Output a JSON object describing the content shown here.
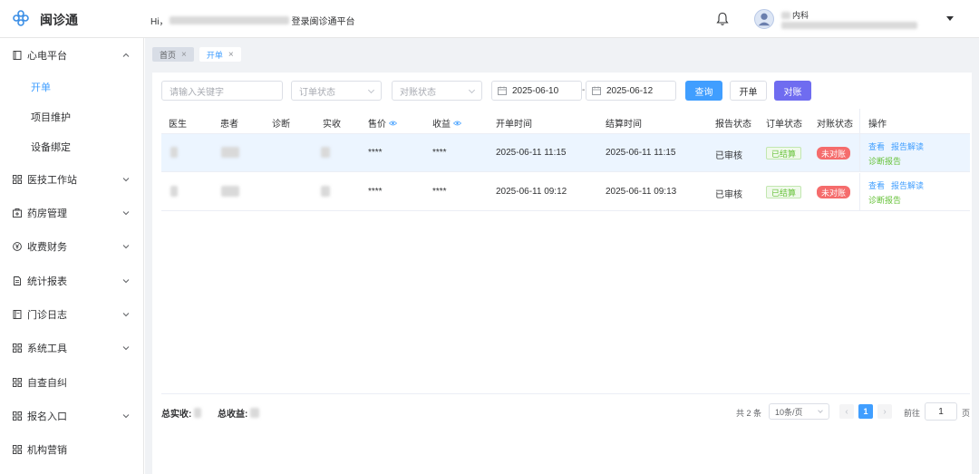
{
  "header": {
    "brand": "闽诊通",
    "greeting_prefix": "Hi，",
    "greeting_suffix": "登录闽诊通平台",
    "user_dept": "内科"
  },
  "sidebar": {
    "groups": [
      {
        "label": "心电平台",
        "icon": "book-icon",
        "expanded": true,
        "children": [
          {
            "label": "开单",
            "active": true
          },
          {
            "label": "项目维护"
          },
          {
            "label": "设备绑定"
          }
        ]
      },
      {
        "label": "医技工作站",
        "icon": "grid-icon"
      },
      {
        "label": "药房管理",
        "icon": "pharmacy-icon"
      },
      {
        "label": "收费财务",
        "icon": "yen-icon"
      },
      {
        "label": "统计报表",
        "icon": "document-icon"
      },
      {
        "label": "门诊日志",
        "icon": "notebook-icon"
      },
      {
        "label": "系统工具",
        "icon": "grid-icon"
      },
      {
        "label": "自查自纠",
        "icon": "grid-icon"
      },
      {
        "label": "报名入口",
        "icon": "grid-icon"
      },
      {
        "label": "机构营销",
        "icon": "grid-icon"
      }
    ]
  },
  "tabs": [
    {
      "label": "首页"
    },
    {
      "label": "开单",
      "active": true
    }
  ],
  "filters": {
    "keyword_placeholder": "请输入关键字",
    "order_status_placeholder": "订单状态",
    "recon_status_placeholder": "对账状态",
    "date_start": "2025-06-10",
    "date_end": "2025-06-12",
    "date_separator": "-",
    "query_label": "查询",
    "create_label": "开单",
    "reconcile_label": "对账"
  },
  "table": {
    "columns": [
      "医生",
      "患者",
      "诊断",
      "实收",
      "售价",
      "收益",
      "开单时间",
      "结算时间",
      "报告状态",
      "订单状态",
      "对账状态",
      "操作"
    ],
    "rows": [
      {
        "price": "****",
        "profit": "****",
        "open_time": "2025-06-11 11:15",
        "settle_time": "2025-06-11 11:15",
        "report_status": "已审核",
        "order_status": "已结算",
        "recon_status": "未对账",
        "actions": [
          "查看",
          "报告解读",
          "诊断报告"
        ]
      },
      {
        "price": "****",
        "profit": "****",
        "open_time": "2025-06-11 09:12",
        "settle_time": "2025-06-11 09:13",
        "report_status": "已审核",
        "order_status": "已结算",
        "recon_status": "未对账",
        "actions": [
          "查看",
          "报告解读",
          "诊断报告"
        ]
      }
    ]
  },
  "footer": {
    "total_received_label": "总实收:",
    "total_profit_label": "总收益:",
    "total_count": "共 2 条",
    "page_size": "10条/页",
    "current_page": "1",
    "goto_prefix": "前往",
    "goto_value": "1",
    "goto_suffix": "页"
  },
  "colors": {
    "primary": "#409eff",
    "purple": "#6f6cf0",
    "success": "#67c23a",
    "danger": "#f56c6c"
  }
}
